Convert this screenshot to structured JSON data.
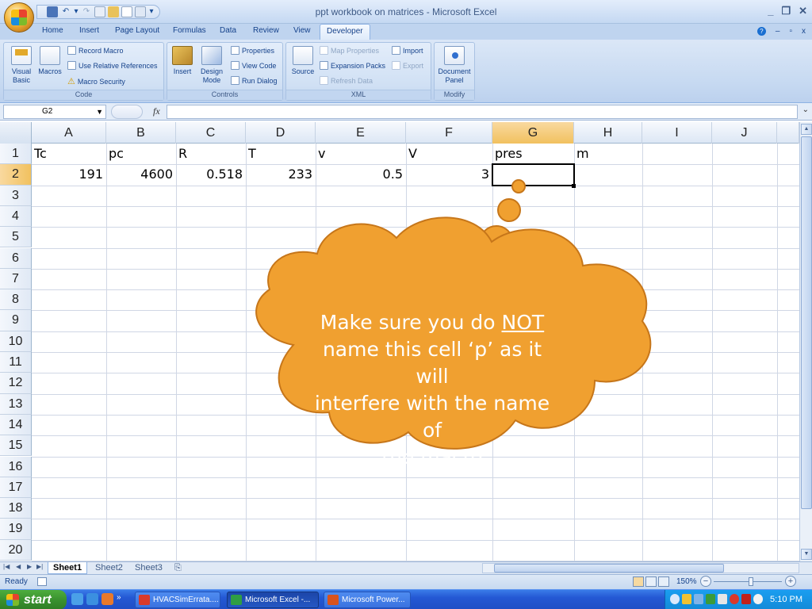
{
  "window": {
    "title": "ppt workbook on matrices - Microsoft Excel",
    "controls": [
      "_",
      "❐",
      "✕"
    ]
  },
  "ribbon_tabs": [
    {
      "label": "Home"
    },
    {
      "label": "Insert"
    },
    {
      "label": "Page Layout"
    },
    {
      "label": "Formulas"
    },
    {
      "label": "Data"
    },
    {
      "label": "Review"
    },
    {
      "label": "View"
    },
    {
      "label": "Developer",
      "active": true
    }
  ],
  "ribbon": {
    "code": {
      "label": "Code",
      "visual_basic": "Visual Basic",
      "macros": "Macros",
      "record_macro": "Record Macro",
      "use_relative_references": "Use Relative References",
      "macro_security": "Macro Security"
    },
    "controls": {
      "label": "Controls",
      "insert": "Insert",
      "design_mode": "Design Mode",
      "properties": "Properties",
      "view_code": "View Code",
      "run_dialog": "Run Dialog"
    },
    "xml": {
      "label": "XML",
      "source": "Source",
      "map_properties": "Map Properties",
      "expansion_packs": "Expansion Packs",
      "refresh_data": "Refresh Data",
      "import": "Import",
      "export": "Export"
    },
    "modify": {
      "label": "Modify",
      "document_panel": "Document Panel"
    }
  },
  "formula_bar": {
    "name_box": "G2",
    "fx": "fx",
    "content": ""
  },
  "grid": {
    "columns": [
      "A",
      "B",
      "C",
      "D",
      "E",
      "F",
      "G",
      "H",
      "I",
      "J"
    ],
    "rows": [
      "1",
      "2",
      "3",
      "4",
      "5",
      "6",
      "7",
      "8",
      "9",
      "10",
      "11",
      "12",
      "13",
      "14",
      "15",
      "16",
      "17",
      "18",
      "19",
      "20"
    ],
    "selected_cell": "G2",
    "row1": [
      "Tc",
      "pc",
      "R",
      "T",
      "v",
      "V",
      "pres",
      "m"
    ],
    "row2": [
      "191",
      "4600",
      "0.518",
      "233",
      "0.5",
      "3"
    ]
  },
  "callout": {
    "line1_prefix": "Make sure you do ",
    "line1_underlined": "NOT",
    "line2": "name this cell ‘p’ as it will",
    "line3": "interfere with the name of",
    "line4": "the macro",
    "fill_color": "#f0a030",
    "stroke_color": "#c6761a"
  },
  "sheet_tabs": [
    "Sheet1",
    "Sheet2",
    "Sheet3"
  ],
  "status": {
    "text": "Ready",
    "zoom": "150%"
  },
  "taskbar": {
    "start": "start",
    "buttons": [
      "HVACSimErrata....",
      "Microsoft Excel -...",
      "Microsoft Power..."
    ],
    "clock": "5:10 PM"
  },
  "colors": {
    "accent": "#15428b",
    "selected_header": "#f1c15f",
    "taskbar": "#2458d4"
  }
}
